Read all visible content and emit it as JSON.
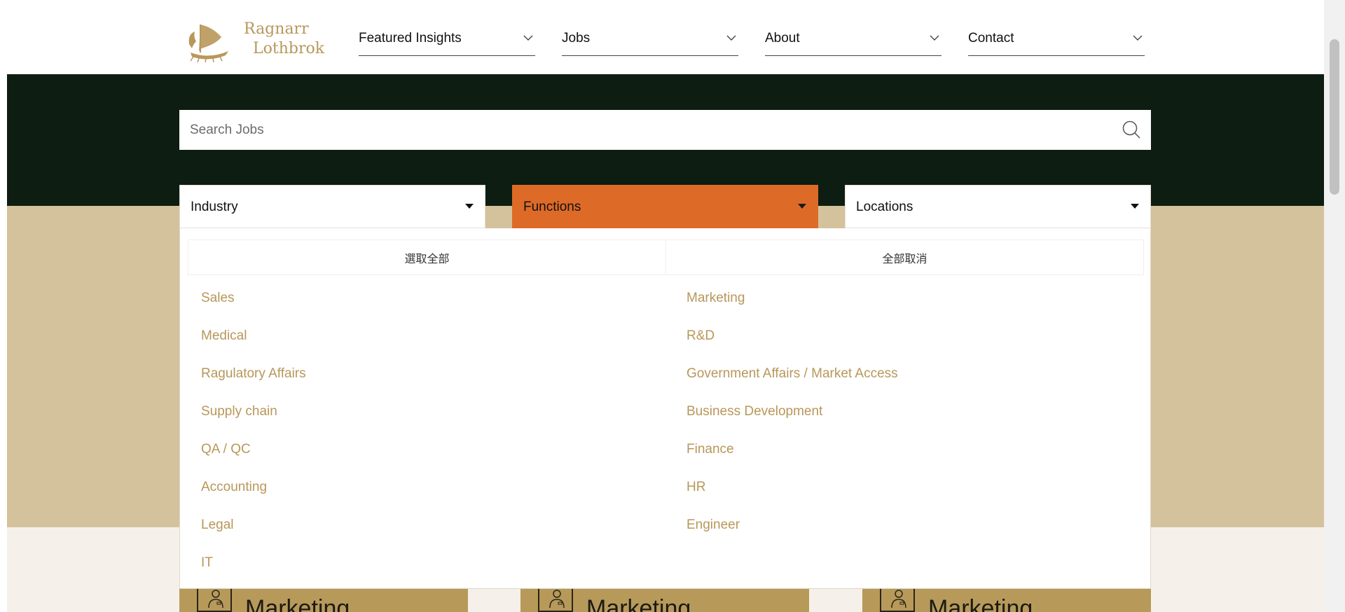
{
  "brand": {
    "line1": "Ragnarr",
    "line2": "Lothbrok",
    "icon": "viking-ship-logo",
    "color": "#b8975a"
  },
  "nav": [
    {
      "label": "Featured Insights",
      "icon": "chevron-down-icon"
    },
    {
      "label": "Jobs",
      "icon": "chevron-down-icon"
    },
    {
      "label": "About",
      "icon": "chevron-down-icon"
    },
    {
      "label": "Contact",
      "icon": "chevron-down-icon"
    }
  ],
  "search": {
    "placeholder": "Search Jobs",
    "value": "",
    "icon": "search-icon"
  },
  "filters": {
    "industry": {
      "label": "Industry"
    },
    "functions": {
      "label": "Functions",
      "active": true,
      "color": "#de6a28"
    },
    "locations": {
      "label": "Locations"
    }
  },
  "functions_panel": {
    "select_all": "選取全部",
    "deselect_all": "全部取消",
    "options": [
      "Sales",
      "Marketing",
      "Medical",
      "R&D",
      "Ragulatory Affairs",
      "Government Affairs / Market Access",
      "Supply chain",
      "Business Development",
      "QA / QC",
      "Finance",
      "Accounting",
      "HR",
      "Legal",
      "Engineer",
      "IT"
    ]
  },
  "cards": [
    {
      "title": "Marketing",
      "icon": "person-badge-icon"
    },
    {
      "title": "Marketing",
      "icon": "person-badge-icon"
    },
    {
      "title": "Marketing",
      "icon": "person-badge-icon"
    }
  ],
  "colors": {
    "hero_dark": "#0d1d11",
    "hero_tan": "#d3c29b",
    "accent_gold": "#b8975a",
    "card_gold": "#b79a5a"
  }
}
